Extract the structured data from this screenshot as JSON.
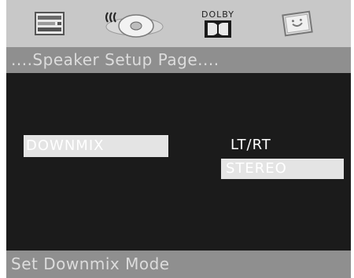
{
  "tabs": [
    {
      "icon": "general-setup-icon"
    },
    {
      "icon": "speaker-audio-icon"
    },
    {
      "icon": "dolby-icon",
      "label": "DOLBY"
    },
    {
      "icon": "preference-icon"
    }
  ],
  "header": {
    "title": "....Speaker Setup Page...."
  },
  "menu": {
    "downmix_label": "DOWNMIX"
  },
  "options": {
    "ltrt": "LT/RT",
    "stereo": "STEREO"
  },
  "status": {
    "text": "Set Downmix Mode"
  },
  "colors": {
    "top_bar": "#c8c8c8",
    "title_bar": "#8f8f8f",
    "background": "#1b1b1b",
    "highlight": "#e4e4e4"
  }
}
